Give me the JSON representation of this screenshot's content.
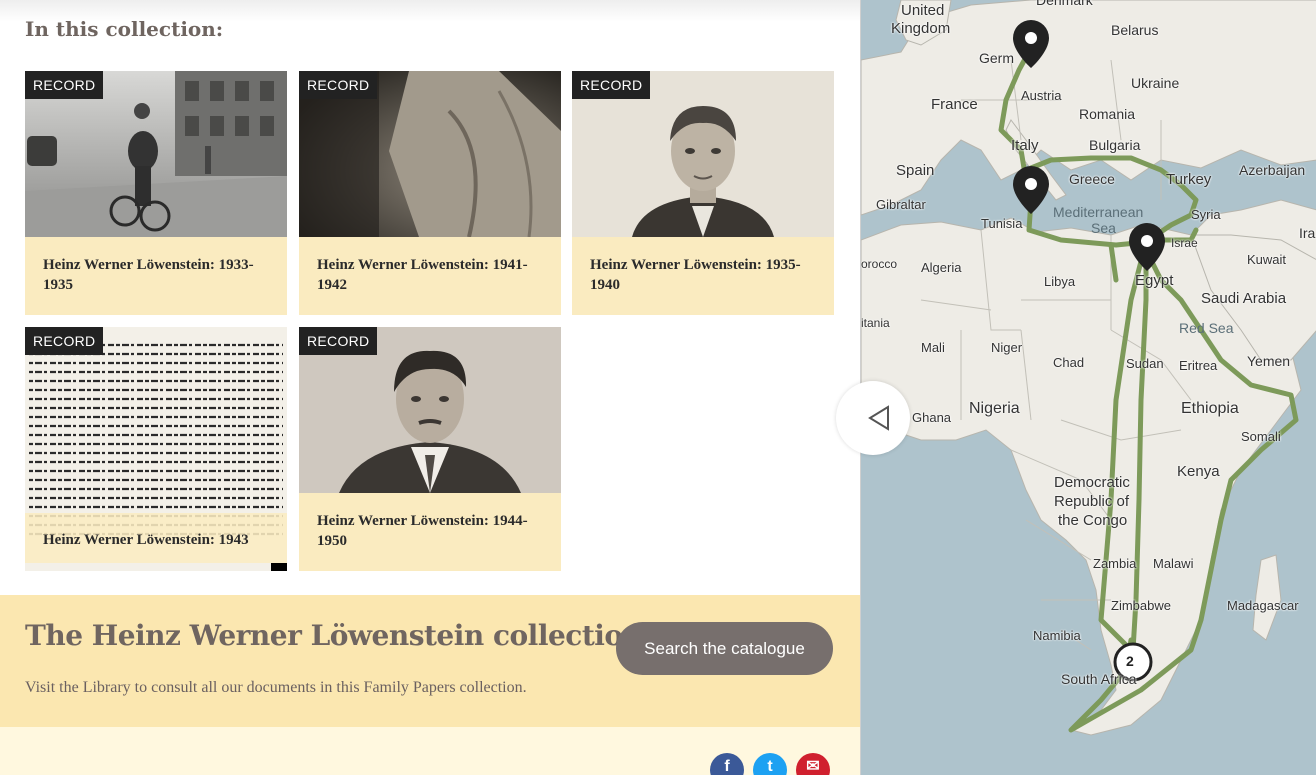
{
  "collection": {
    "heading": "In this collection:",
    "records": [
      {
        "badge": "RECORD",
        "title": "Heinz Werner Löwenstein: 1933-1935"
      },
      {
        "badge": "RECORD",
        "title": "Heinz Werner Löwenstein: 1941-1942"
      },
      {
        "badge": "RECORD",
        "title": "Heinz Werner Löwenstein: 1935-1940"
      },
      {
        "badge": "RECORD",
        "title": "Heinz Werner Löwenstein: 1943"
      },
      {
        "badge": "RECORD",
        "title": "Heinz Werner Löwenstein: 1944-1950"
      }
    ]
  },
  "banner": {
    "title": "The Heinz Werner Löwenstein collection",
    "description": "Visit the Library to consult all our documents in this Family Papers collection.",
    "search_label": "Search the catalogue"
  },
  "social": [
    {
      "name": "facebook",
      "glyph": "f",
      "color": "#3b5998"
    },
    {
      "name": "twitter",
      "glyph": "t",
      "color": "#1da1f2"
    },
    {
      "name": "email",
      "glyph": "✉",
      "color": "#d0202e"
    }
  ],
  "map": {
    "labels": [
      "Denmark",
      "United",
      "Kingdom",
      "Belarus",
      "Germ",
      "Ukraine",
      "France",
      "Austria",
      "Romania",
      "Italy",
      "Bulgaria",
      "Spain",
      "Greece",
      "Turkey",
      "Azerbaijan",
      "Gibraltar",
      "Mediterranean",
      "Sea",
      "Tunisia",
      "Syria",
      "Israe",
      "Ira",
      "Algeria",
      "Libya",
      "Egypt",
      "Kuwait",
      "orocco",
      "Saudi Arabia",
      "itania",
      "Red Sea",
      "Mali",
      "Niger",
      "Chad",
      "Sudan",
      "Eritrea",
      "Yemen",
      "Ghana",
      "Nigeria",
      "Ethiopia",
      "Somali",
      "Kenya",
      "Democratic",
      "Republic of",
      "the Congo",
      "Zambia",
      "Malawi",
      "Zimbabwe",
      "Madagascar",
      "Namibia",
      "South Africa"
    ],
    "cluster_count": "2",
    "route_color": "#7d9a5a"
  }
}
